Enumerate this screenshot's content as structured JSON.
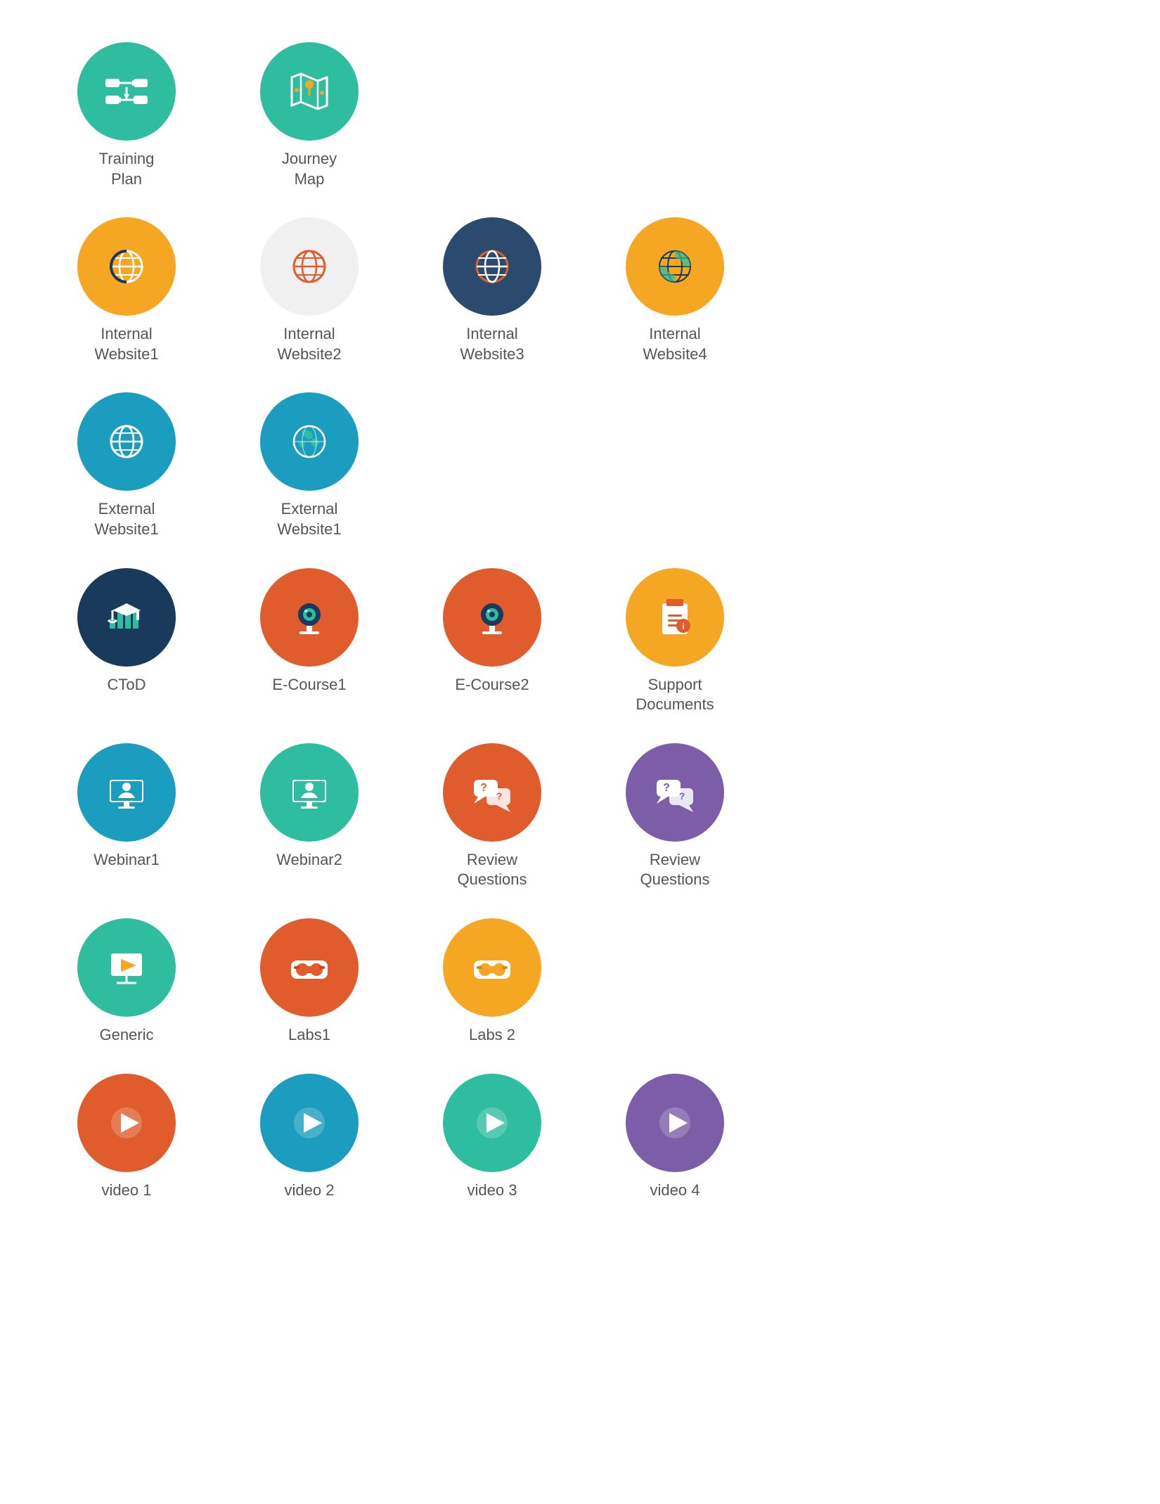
{
  "items": [
    {
      "id": "training-plan",
      "label": "Training\nPlan",
      "color": "#2EBD9E",
      "icon": "training-plan"
    },
    {
      "id": "journey-map",
      "label": "Journey\nMap",
      "color": "#2EBD9E",
      "icon": "journey-map"
    },
    {
      "id": "internal-website1",
      "label": "Internal\nWebsite1",
      "color": "#F5A623",
      "icon": "globe-orange"
    },
    {
      "id": "internal-website2",
      "label": "Internal\nWebsite2",
      "color": "#E8E8E8",
      "icon": "globe-red"
    },
    {
      "id": "internal-website3",
      "label": "Internal\nWebsite3",
      "color": "#2B4A6E",
      "icon": "globe-dark"
    },
    {
      "id": "internal-website4",
      "label": "Internal\nWebsite4",
      "color": "#F5A623",
      "icon": "globe-yellow-dark"
    },
    {
      "id": "external-website1",
      "label": "External\nWebsite1",
      "color": "#1A9DBF",
      "icon": "globe-teal"
    },
    {
      "id": "external-website2",
      "label": "External\nWebsite1",
      "color": "#1A9DBF",
      "icon": "globe-earth"
    },
    {
      "id": "ctod",
      "label": "CToD",
      "color": "#1A3A5C",
      "icon": "ctod"
    },
    {
      "id": "ecourse1",
      "label": "E-Course1",
      "color": "#E05C2C",
      "icon": "webcam-orange"
    },
    {
      "id": "ecourse2",
      "label": "E-Course2",
      "color": "#E05C2C",
      "icon": "webcam-orange"
    },
    {
      "id": "support-documents",
      "label": "Support\nDocuments",
      "color": "#F5A623",
      "icon": "document"
    },
    {
      "id": "webinar1",
      "label": "Webinar1",
      "color": "#1A9DBF",
      "icon": "webinar-blue"
    },
    {
      "id": "webinar2",
      "label": "Webinar2",
      "color": "#2EBD9E",
      "icon": "webinar-teal"
    },
    {
      "id": "review-questions1",
      "label": "Review\nQuestions",
      "color": "#E05C2C",
      "icon": "review-orange"
    },
    {
      "id": "review-questions2",
      "label": "Review\nQuestions",
      "color": "#7B5EA7",
      "icon": "review-purple"
    },
    {
      "id": "generic",
      "label": "Generic",
      "color": "#2EBD9E",
      "icon": "generic"
    },
    {
      "id": "labs1",
      "label": "Labs1",
      "color": "#E05C2C",
      "icon": "labs"
    },
    {
      "id": "labs2",
      "label": "Labs 2",
      "color": "#F5A623",
      "icon": "labs-yellow"
    },
    {
      "id": "video1",
      "label": "video 1",
      "color": "#E05C2C",
      "icon": "play-red"
    },
    {
      "id": "video2",
      "label": "video 2",
      "color": "#1A9DBF",
      "icon": "play-blue"
    },
    {
      "id": "video3",
      "label": "video 3",
      "color": "#2EBD9E",
      "icon": "play-teal"
    },
    {
      "id": "video4",
      "label": "video 4",
      "color": "#7B5EA7",
      "icon": "play-purple"
    }
  ]
}
